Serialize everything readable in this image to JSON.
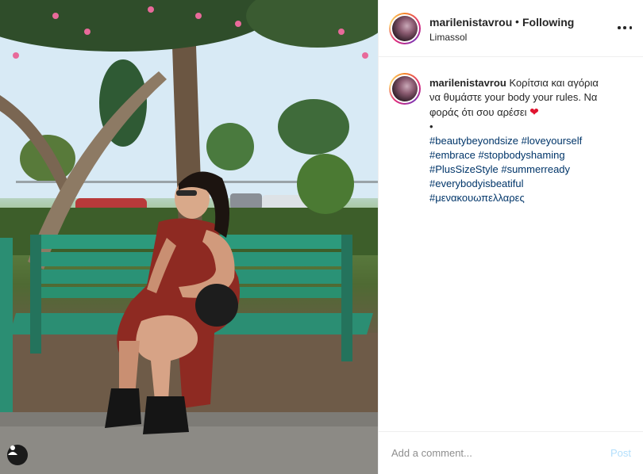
{
  "post": {
    "username": "marilenistavrou",
    "separator": "•",
    "follow_status": "Following",
    "location": "Limassol",
    "caption": {
      "username": "marilenistavrou",
      "text_line1": " Κορίτσια και αγόρια",
      "text_line2": "να θυμάστε your body your rules. Να",
      "text_line3": "φοράς ότι σου αρέσει ",
      "heart": "❤",
      "bullet": "•",
      "hashtags": [
        [
          "#beautybeyondsize",
          "#loveyourself"
        ],
        [
          "#embrace",
          "#stopbodyshaming"
        ],
        [
          "#PlusSizeStyle",
          "#summerready"
        ],
        [
          "#everybodyisbeatiful"
        ],
        [
          "#μενακουωπελλαρες"
        ]
      ]
    },
    "comment_box": {
      "placeholder": "Add a comment...",
      "post_label": "Post"
    }
  },
  "colors": {
    "hashtag": "#003569",
    "post_button_disabled": "#b2dffc",
    "text": "#262626",
    "muted": "#8e8e8e"
  },
  "icons": {
    "more": "more-options-icon",
    "user_tag": "user-tag-icon"
  }
}
